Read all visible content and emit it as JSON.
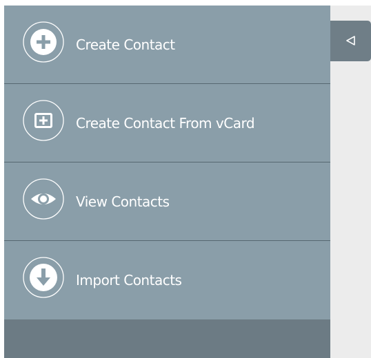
{
  "menu": {
    "items": [
      {
        "label": "Create Contact",
        "icon": "plus-circle-icon"
      },
      {
        "label": "Create Contact From vCard",
        "icon": "vcard-plus-icon"
      },
      {
        "label": "View Contacts",
        "icon": "eye-icon"
      },
      {
        "label": "Import Contacts",
        "icon": "download-arrow-icon"
      }
    ]
  },
  "colors": {
    "menu_item_bg": "#8a9ea9",
    "panel_bottom": "#6c7b84",
    "separator": "#566770",
    "toggle_tab": "#6f7e87",
    "content_bg": "#ececec",
    "text": "#ffffff"
  }
}
